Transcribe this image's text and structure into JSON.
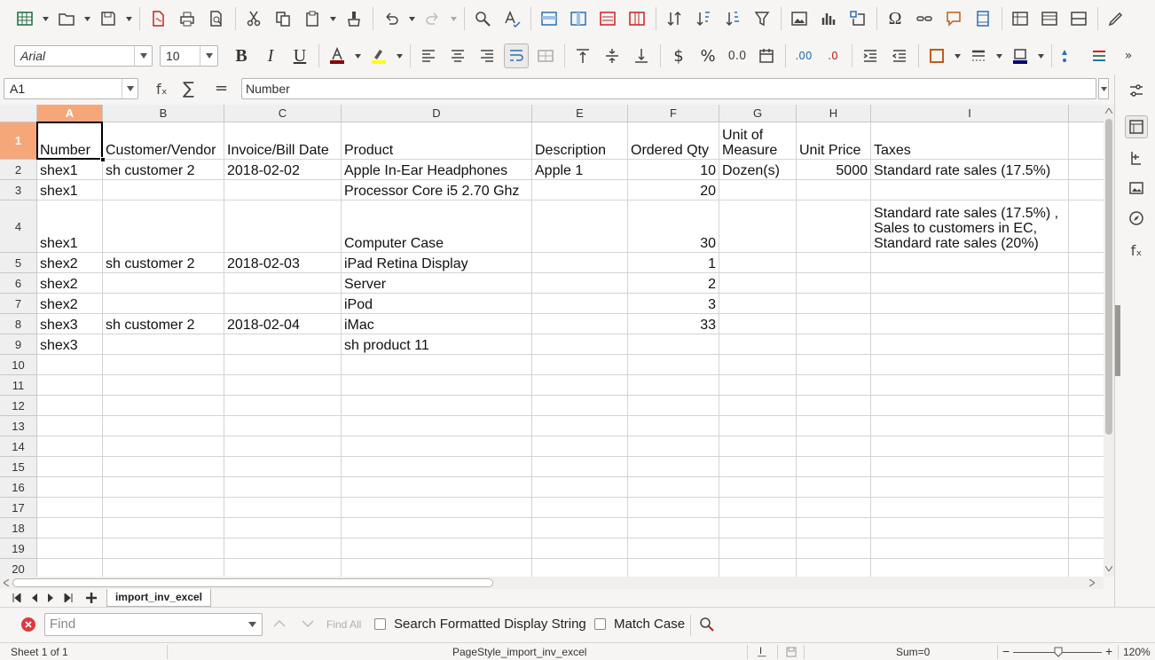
{
  "font": {
    "name": "Arial",
    "size": "10"
  },
  "name_box": "A1",
  "formula": {
    "fx": "fₓ",
    "sum": "∑",
    "eq": "=",
    "value": "Number"
  },
  "columns": [
    "A",
    "B",
    "C",
    "D",
    "E",
    "F",
    "G",
    "H",
    "I"
  ],
  "rows": [
    "1",
    "2",
    "3",
    "4",
    "5",
    "6",
    "7",
    "8",
    "9",
    "10",
    "11",
    "12",
    "13",
    "14",
    "15",
    "16",
    "17",
    "18",
    "19",
    "20"
  ],
  "table": {
    "header": [
      "Number",
      "Customer/Vendor",
      "Invoice/Bill Date",
      "Product",
      "Description",
      "Ordered Qty",
      "Unit of Measure",
      "Unit Price",
      "Taxes"
    ],
    "rows": [
      [
        "shex1",
        "sh customer 2",
        "2018-02-02",
        "Apple In-Ear Headphones",
        "Apple 1",
        "10",
        "Dozen(s)",
        "5000",
        "Standard rate sales (17.5%)"
      ],
      [
        "shex1",
        "",
        "",
        "Processor Core i5 2.70 Ghz",
        "",
        "20",
        "",
        "",
        ""
      ],
      [
        "shex1",
        "",
        "",
        "Computer Case",
        "",
        "30",
        "",
        "",
        "Standard rate sales (17.5%) ,\nSales to customers in EC,\nStandard rate sales (20%)"
      ],
      [
        "shex2",
        "sh customer 2",
        "2018-02-03",
        "iPad Retina Display",
        "",
        "1",
        "",
        "",
        ""
      ],
      [
        "shex2",
        "",
        "",
        "Server",
        "",
        "2",
        "",
        "",
        ""
      ],
      [
        "shex2",
        "",
        "",
        "iPod",
        "",
        "3",
        "",
        "",
        ""
      ],
      [
        "shex3",
        "sh customer 2",
        "2018-02-04",
        "iMac",
        "",
        "33",
        "",
        "",
        ""
      ],
      [
        "shex3",
        "",
        "",
        "sh product 11",
        "",
        "",
        "",
        "",
        ""
      ]
    ]
  },
  "sheet_tab": "import_inv_excel",
  "find": {
    "placeholder": "Find",
    "find_all": "Find All",
    "formatted": "Search Formatted Display String",
    "match_case": "Match Case"
  },
  "status": {
    "sheet": "Sheet 1 of 1",
    "page_style": "PageStyle_import_inv_excel",
    "sum": "Sum=0",
    "zoom": "120%"
  },
  "colors": {
    "selection": "#f5a77a",
    "font_color": "#c9211e",
    "highlight": "#ffff00",
    "border_color": "#c65911"
  },
  "icons": {
    "toolbar1": [
      "spreadsheet-new-icon",
      "open-icon",
      "save-icon",
      "export-pdf-icon",
      "print-icon",
      "print-preview-icon",
      "cut-icon",
      "copy-icon",
      "paste-icon",
      "clone-format-icon",
      "undo-icon",
      "redo-icon",
      "find-replace-icon",
      "spelling-icon",
      "row-icon",
      "column-icon",
      "delete-row-icon",
      "delete-column-icon",
      "sort-icon",
      "sort-asc-icon",
      "sort-desc-icon",
      "autofilter-icon",
      "image-icon",
      "chart-icon",
      "pivot-icon",
      "special-char-icon",
      "hyperlink-icon",
      "comment-icon",
      "header-footer-icon",
      "define-print-area-icon",
      "freeze-icon",
      "split-icon",
      "draw-icon"
    ]
  }
}
